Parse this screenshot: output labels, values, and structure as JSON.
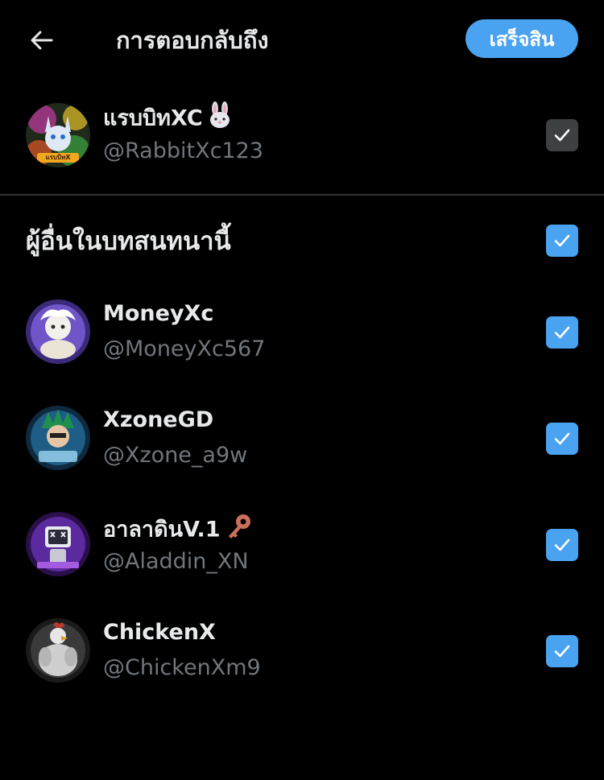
{
  "header": {
    "title": "การตอบกลับถึง",
    "done_label": "เสร็จสิน"
  },
  "primary_user": {
    "name": "แรบบิทXC",
    "name_icon": "rabbit-emoji-icon",
    "handle": "@RabbitXc123",
    "avatar_text": "แรบบิทX",
    "checked": true,
    "checkbox_color": "#3e4144"
  },
  "section": {
    "title": "ผู้อื่นในบทสนทนานี้",
    "all_checked": true
  },
  "others": [
    {
      "name": "MoneyXc",
      "handle": "@MoneyXc567",
      "checked": true
    },
    {
      "name": "XzoneGD",
      "handle": "@Xzone_a9w",
      "checked": true
    },
    {
      "name": "อาลาดินV.1",
      "name_icon": "key-emoji-icon",
      "handle": "@Aladdin_XN",
      "checked": true
    },
    {
      "name": "ChickenX",
      "handle": "@ChickenXm9",
      "checked": true
    }
  ],
  "colors": {
    "background": "#000000",
    "accent": "#4aa3f0",
    "text": "#e7e9ea",
    "muted": "#71767b",
    "divider": "#2f3336"
  },
  "icons": {
    "back": "arrow-left-icon",
    "check": "checkmark-icon"
  }
}
